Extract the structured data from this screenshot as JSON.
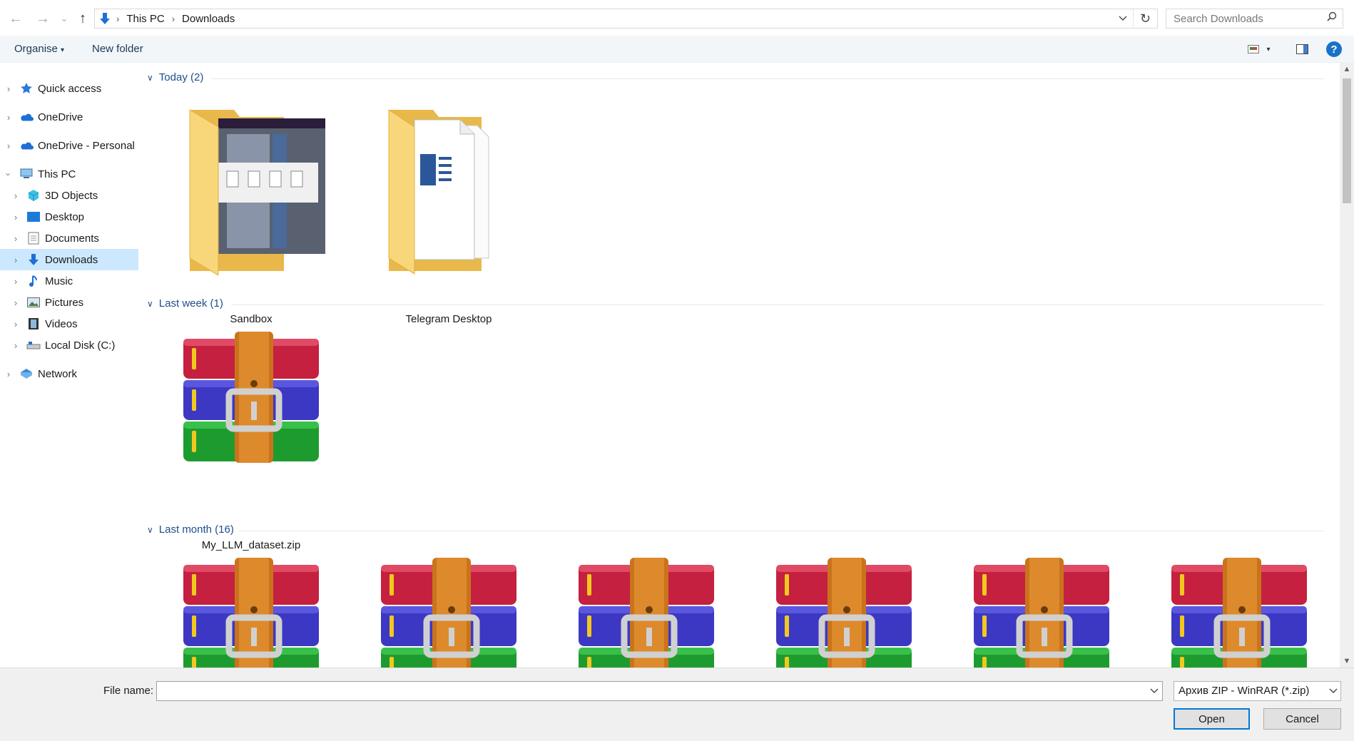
{
  "breadcrumb": {
    "segments": [
      "This PC",
      "Downloads"
    ]
  },
  "search": {
    "placeholder": "Search Downloads"
  },
  "toolbar": {
    "organise": "Organise",
    "new_folder": "New folder"
  },
  "nav": {
    "quick_access": "Quick access",
    "onedrive": "OneDrive",
    "onedrive_personal": "OneDrive - Personal",
    "this_pc": "This PC",
    "objects3d": "3D Objects",
    "desktop": "Desktop",
    "documents": "Documents",
    "downloads": "Downloads",
    "music": "Music",
    "pictures": "Pictures",
    "videos": "Videos",
    "local_disk": "Local Disk (C:)",
    "network": "Network"
  },
  "groups": {
    "today": "Today (2)",
    "last_week": "Last week (1)",
    "last_month": "Last month (16)"
  },
  "files": {
    "sandbox": "Sandbox",
    "telegram": "Telegram Desktop",
    "dataset": "My_LLM_dataset.zip"
  },
  "bottom": {
    "file_name_label": "File name:",
    "file_name_value": "",
    "file_type": "Архив ZIP - WinRAR (*.zip)",
    "open": "Open",
    "cancel": "Cancel"
  },
  "colors": {
    "accent": "#0078d7",
    "selected_bg": "#cce8ff",
    "group_header": "#1e4e8c",
    "folder": "#f6d776"
  }
}
